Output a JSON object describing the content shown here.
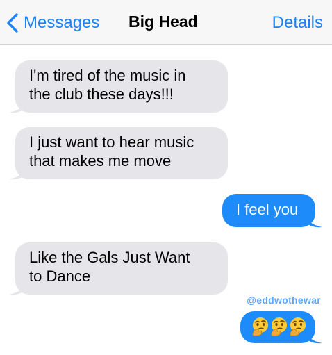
{
  "header": {
    "back_label": "Messages",
    "contact_name": "Big Head",
    "details_label": "Details"
  },
  "messages": [
    {
      "direction": "incoming",
      "lines": [
        "I'm tired of the music in",
        "the club these days!!!"
      ]
    },
    {
      "direction": "incoming",
      "lines": [
        "I just want to hear music",
        "that makes me move"
      ]
    },
    {
      "direction": "outgoing",
      "lines": [
        "I feel you"
      ]
    },
    {
      "direction": "incoming",
      "lines": [
        "Like the Gals Just Want",
        "to Dance"
      ]
    },
    {
      "direction": "outgoing",
      "emoji": [
        "thinking-face",
        "thinking-face",
        "thinking-face"
      ]
    }
  ],
  "watermark": "@eddwothewar",
  "colors": {
    "accent": "#1a82fb",
    "outgoing_bubble": "#1e8bfb",
    "incoming_bubble": "#e5e5ea",
    "watermark": "#5aa8ff"
  },
  "icons": {
    "back": "chevron-left-icon",
    "reaction": "thinking-face-emoji"
  }
}
